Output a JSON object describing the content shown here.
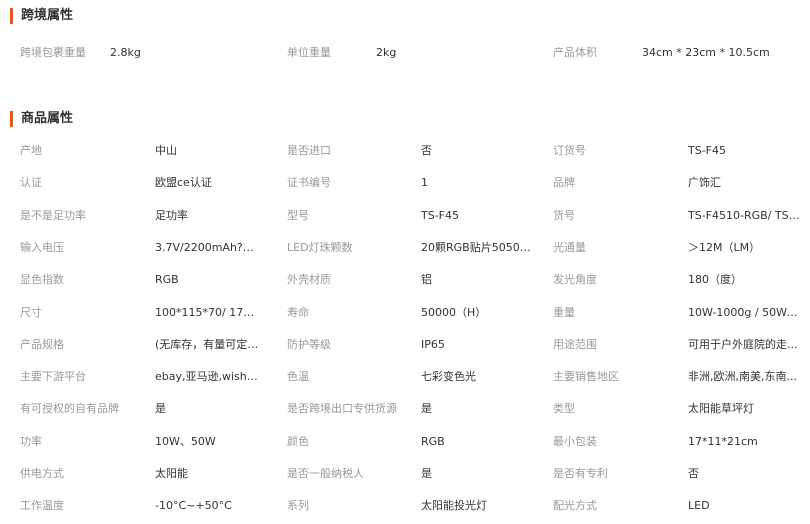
{
  "cross_border": {
    "title": "跨境属性",
    "rows": [
      [
        {
          "label": "跨境包裹重量",
          "value": "2.8kg"
        },
        {
          "label": "单位重量",
          "value": "2kg"
        },
        {
          "label": "产品体积",
          "value": "34cm * 23cm * 10.5cm"
        }
      ]
    ]
  },
  "product": {
    "title": "商品属性",
    "rows": [
      [
        {
          "label": "产地",
          "value": "中山"
        },
        {
          "label": "是否进口",
          "value": "否"
        },
        {
          "label": "订货号",
          "value": "TS-F45"
        }
      ],
      [
        {
          "label": "认证",
          "value": "欧盟ce认证"
        },
        {
          "label": "证书编号",
          "value": "1"
        },
        {
          "label": "品牌",
          "value": "广饰汇"
        }
      ],
      [
        {
          "label": "是不是足功率",
          "value": "足功率"
        },
        {
          "label": "型号",
          "value": "TS-F45"
        },
        {
          "label": "货号",
          "value": "TS-F4510-RGB/ TS-F..."
        }
      ],
      [
        {
          "label": "输入电压",
          "value": "3.7V/2200mAh?1865..."
        },
        {
          "label": "LED灯珠颗数",
          "value": "20颗RGB贴片5050LED"
        },
        {
          "label": "光通量",
          "value": "＞12M（LM）"
        }
      ],
      [
        {
          "label": "显色指数",
          "value": "RGB"
        },
        {
          "label": "外壳材质",
          "value": "铝"
        },
        {
          "label": "发光角度",
          "value": "180（度）"
        }
      ],
      [
        {
          "label": "尺寸",
          "value": "100*115*70/ 175*13..."
        },
        {
          "label": "寿命",
          "value": "50000（H）"
        },
        {
          "label": "重量",
          "value": "10W-1000g / 50W-17..."
        }
      ],
      [
        {
          "label": "产品规格",
          "value": "(无库存，有量可定制..."
        },
        {
          "label": "防护等级",
          "value": "IP65"
        },
        {
          "label": "用途范围",
          "value": "可用于户外庭院的走..."
        }
      ],
      [
        {
          "label": "主要下游平台",
          "value": "ebay,亚马逊,wish,速..."
        },
        {
          "label": "色温",
          "value": "七彩变色光"
        },
        {
          "label": "主要销售地区",
          "value": "非洲,欧洲,南美,东南..."
        }
      ],
      [
        {
          "label": "有可授权的自有品牌",
          "value": "是"
        },
        {
          "label": "是否跨境出口专供货源",
          "value": "是"
        },
        {
          "label": "类型",
          "value": "太阳能草坪灯"
        }
      ],
      [
        {
          "label": "功率",
          "value": "10W、50W"
        },
        {
          "label": "颜色",
          "value": "RGB"
        },
        {
          "label": "最小包装",
          "value": "17*11*21cm"
        }
      ],
      [
        {
          "label": "供电方式",
          "value": "太阳能"
        },
        {
          "label": "是否一般纳税人",
          "value": "是"
        },
        {
          "label": "是否有专利",
          "value": "否"
        }
      ],
      [
        {
          "label": "工作温度",
          "value": "-10°C~+50°C"
        },
        {
          "label": "系列",
          "value": "太阳能投光灯"
        },
        {
          "label": "配光方式",
          "value": "LED"
        }
      ]
    ]
  }
}
